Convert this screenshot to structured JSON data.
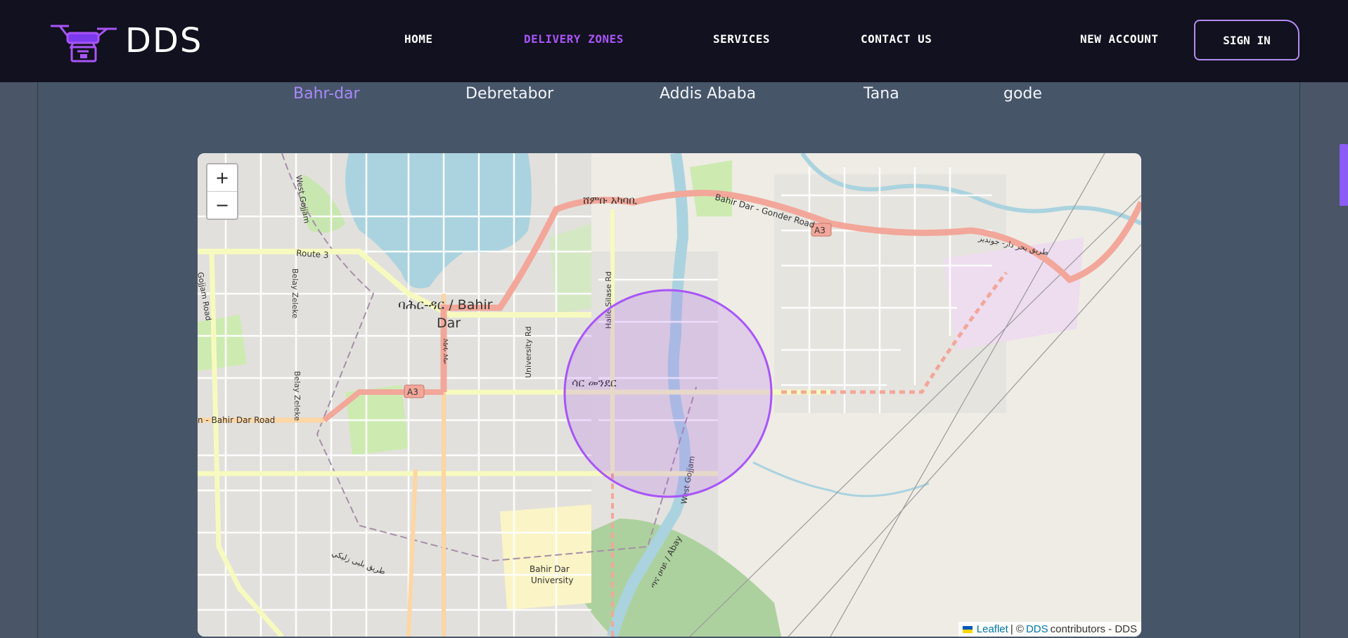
{
  "brand": {
    "name": "DDS",
    "logo_icon": "drone-icon"
  },
  "nav": {
    "links": [
      {
        "label": "HOME",
        "active": false
      },
      {
        "label": "DELIVERY ZONES",
        "active": true
      },
      {
        "label": "SERVICES",
        "active": false
      },
      {
        "label": "CONTACT US",
        "active": false
      }
    ],
    "new_account": "NEW ACCOUNT",
    "sign_in": "SIGN IN"
  },
  "zones": {
    "tabs": [
      "Bahr-dar",
      "Debretabor",
      "Addis Ababa",
      "Tana",
      "gode"
    ],
    "selected": "Bahr-dar"
  },
  "map": {
    "zoom_in": "+",
    "zoom_out": "−",
    "attribution": {
      "leaflet": "Leaflet",
      "separator": "| ©",
      "osm": "DDS",
      "suffix": "contributors - DDS"
    },
    "labels": {
      "city": "ባሕር-ዳር / Bahir",
      "city2": "Dar",
      "district": "ሳር መንደር",
      "road_gonder": "Bahir Dar - Gonder Road",
      "road_bahir": "n - Bahir Dar Road",
      "a3_1": "A3",
      "a3_2": "A3",
      "route3": "Route 3",
      "belay1": "Belay Zeleke",
      "belay2": "Belay Zeleke",
      "university_rd": "University Rd",
      "haile": "Haile Silase Rd",
      "west_gojjam": "West Gojjam",
      "river_abay": "ጣና ዐባይ / Abay",
      "west_gojjam2": "West Gojjam",
      "university1": "Bahir Dar",
      "university2": "University",
      "amharic_top": "ሸምቡ አካባቢ",
      "arabic1": "طريق بحر دار- جوندير",
      "arabic2": "طريق بليى زليكي",
      "gojjam_road": "Gojjam Road",
      "tana_road": "ጣና ጎዳና"
    },
    "zone_color": "#a855f7"
  },
  "colors": {
    "accent": "#a855f7",
    "navbar_bg": "#12111f",
    "page_bg": "#4a5568"
  }
}
